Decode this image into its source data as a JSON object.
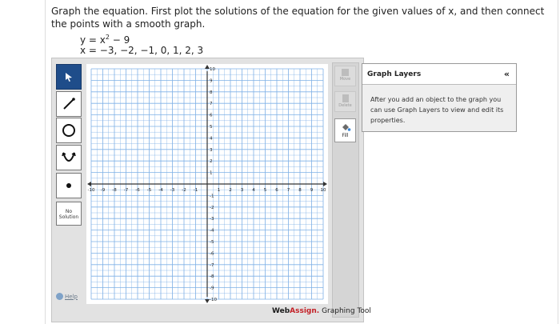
{
  "question": {
    "text": "Graph the equation. First plot the solutions of the equation for the given values of x, and then connect the points with a smooth graph.",
    "equation_prefix": "y = x",
    "equation_exp": "2",
    "equation_suffix": " − 9",
    "x_values": "x = −3, −2, −1, 0, 1, 2, 3"
  },
  "toolbar": {
    "tools": [
      {
        "name": "pointer",
        "icon": "arrow-pointer-icon",
        "selected": true
      },
      {
        "name": "line",
        "icon": "line-segment-icon",
        "selected": false
      },
      {
        "name": "circle",
        "icon": "circle-icon",
        "selected": false
      },
      {
        "name": "parabola",
        "icon": "parabola-icon",
        "selected": false
      },
      {
        "name": "point",
        "icon": "point-icon",
        "selected": false
      }
    ],
    "no_solution_line1": "No",
    "no_solution_line2": "Solution",
    "help_label": "Help"
  },
  "graph": {
    "x_min": -10,
    "x_max": 10,
    "y_min": -10,
    "y_max": 10,
    "x_ticks": [
      "-10",
      "-9",
      "-8",
      "-7",
      "-6",
      "-5",
      "-4",
      "-3",
      "-2",
      "-1",
      "1",
      "2",
      "3",
      "4",
      "5",
      "6",
      "7",
      "8",
      "9",
      "10"
    ],
    "y_ticks": [
      "10",
      "9",
      "8",
      "7",
      "6",
      "5",
      "4",
      "3",
      "2",
      "1",
      "-1",
      "-2",
      "-3",
      "-4",
      "-5",
      "-6",
      "-7",
      "-8",
      "-9",
      "-10"
    ],
    "grid_color": "#7fb0e6",
    "axis_color": "#333333"
  },
  "right_tools": {
    "move_label": "Move",
    "delete_label": "Delete",
    "fill_label": "Fill"
  },
  "branding": {
    "web": "Web",
    "assign": "Assign.",
    "tail": " Graphing Tool"
  },
  "layers_panel": {
    "title": "Graph Layers",
    "collapse": "«",
    "body": "After you add an object to the graph you can use Graph Layers to view and edit its properties."
  }
}
